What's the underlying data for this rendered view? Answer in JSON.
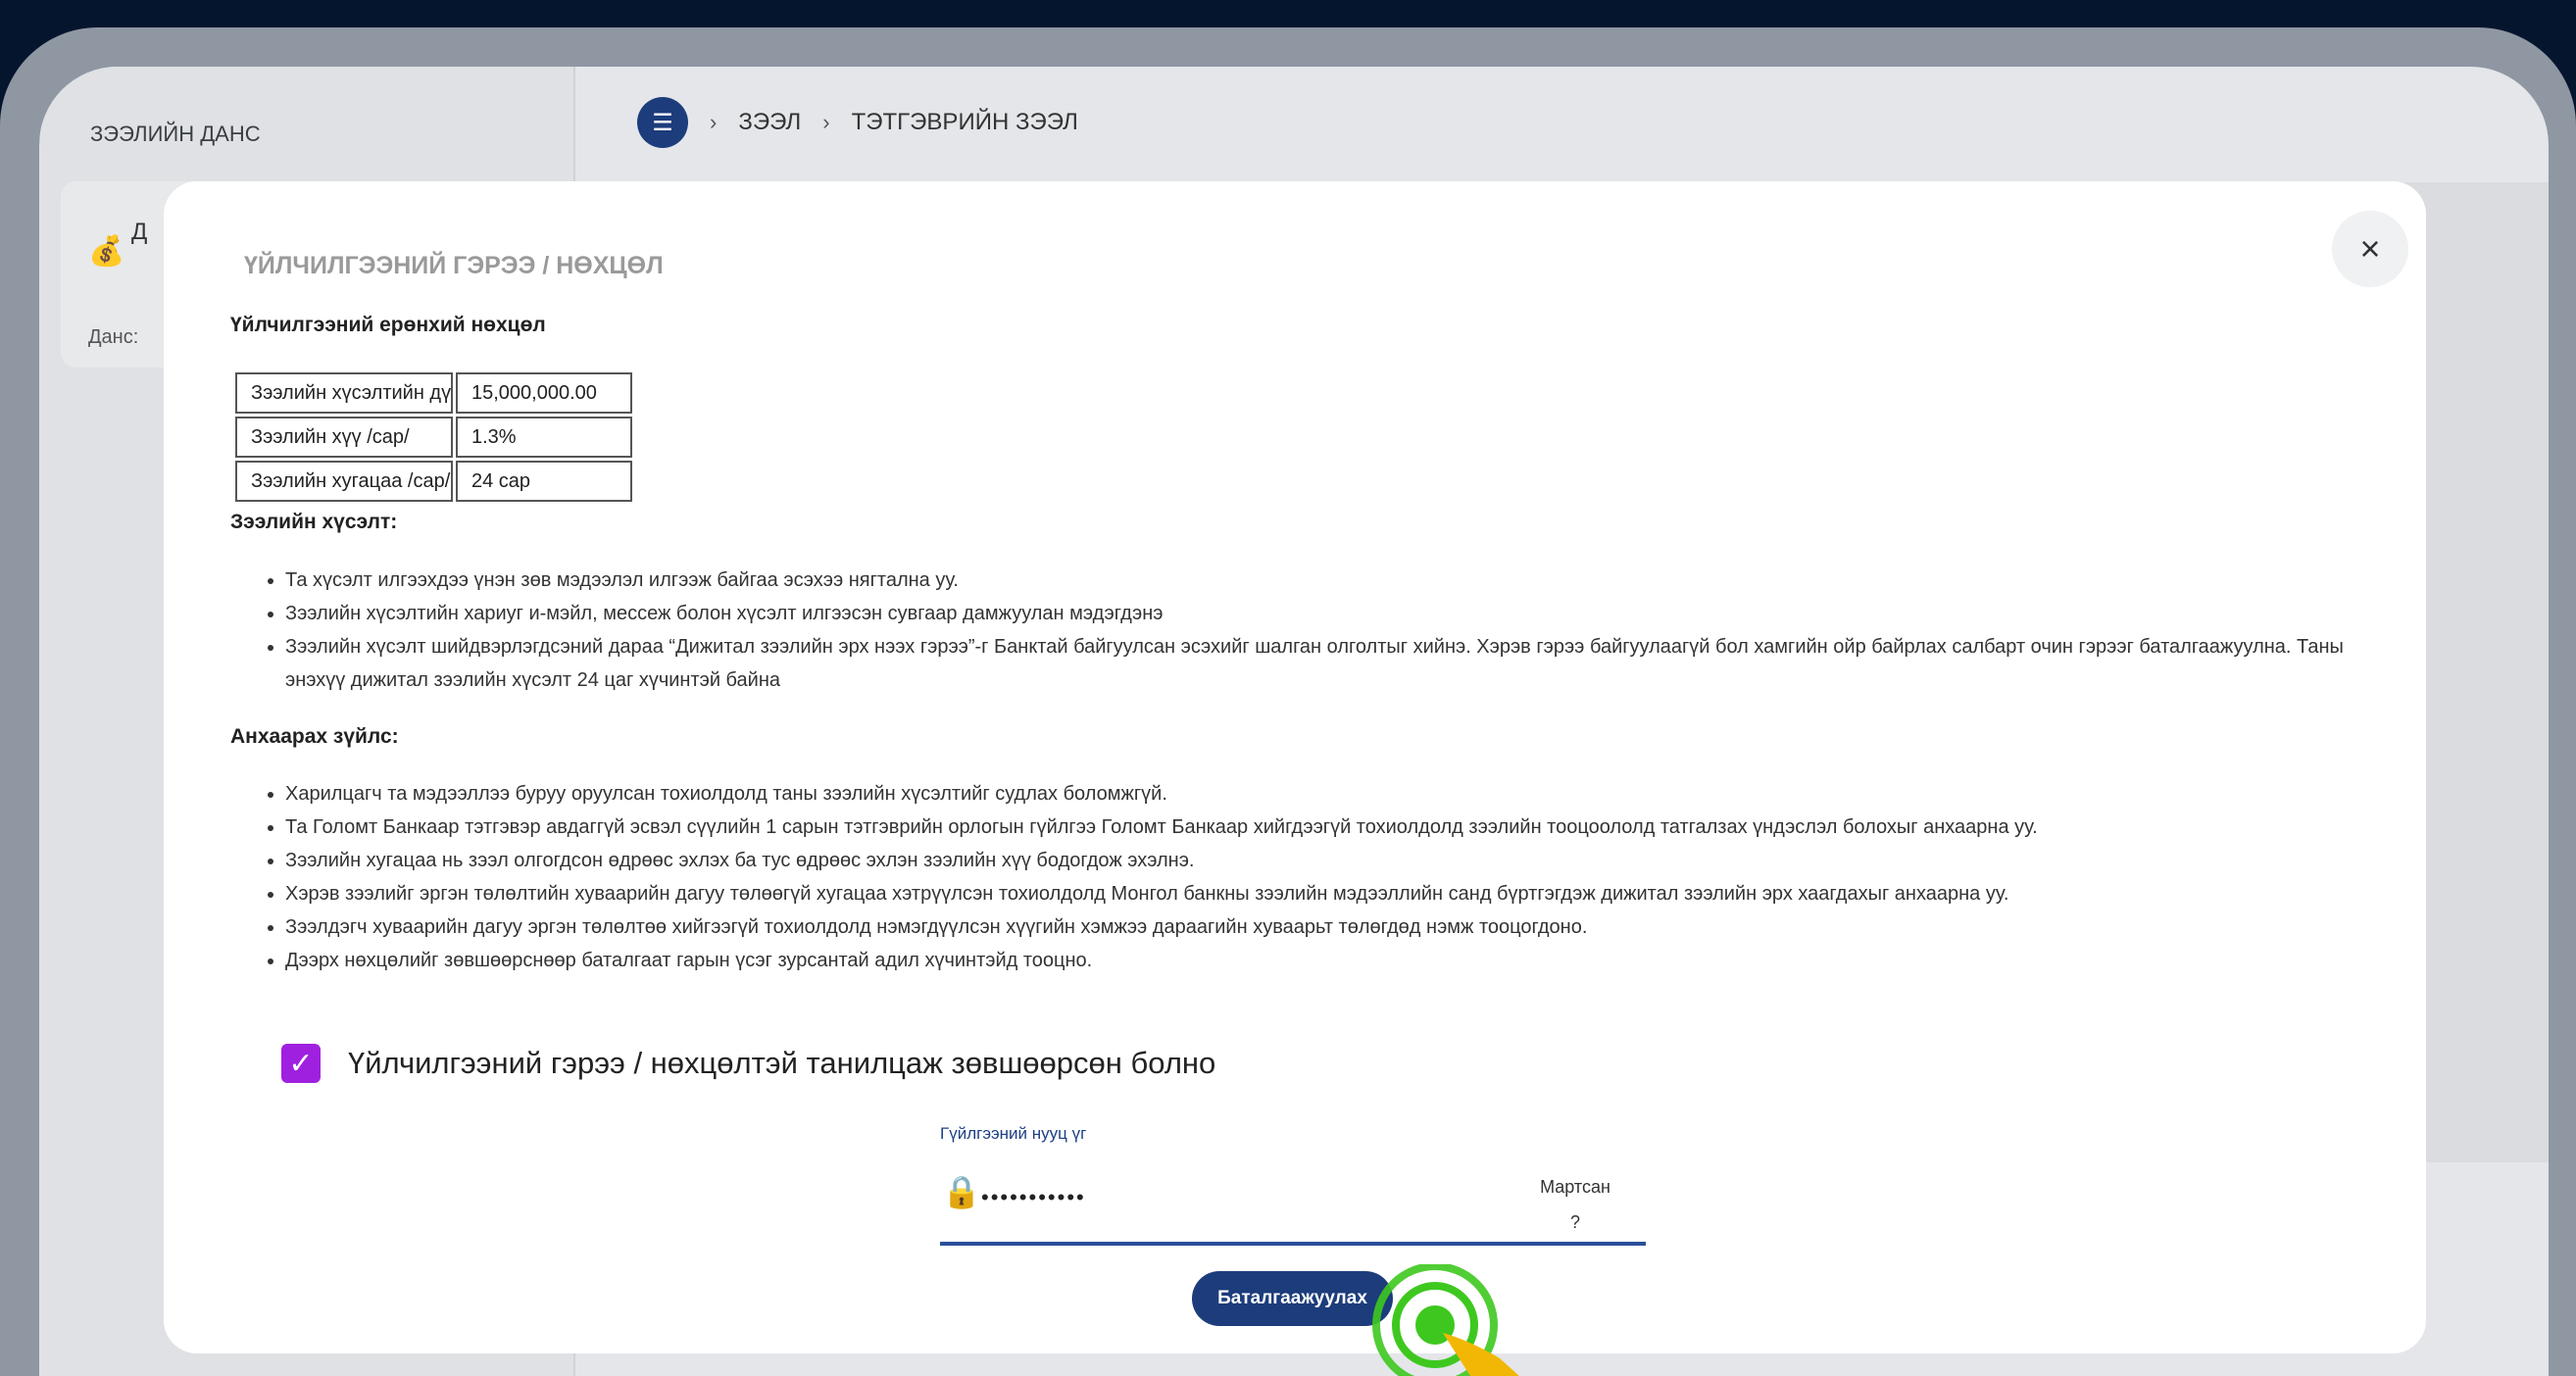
{
  "sidebar": {
    "title": "ЗЭЭЛИЙН ДАНС",
    "account_name": "Д",
    "account_label": "Данс:"
  },
  "breadcrumb": [
    "ЗЭЭЛ",
    "ТЭТГЭВРИЙН ЗЭЭЛ"
  ],
  "modal": {
    "title": "ҮЙЛЧИЛГЭЭНИЙ ГЭРЭЭ / НӨХЦӨЛ",
    "close": "×",
    "general_title": "Үйлчилгээний ерөнхий нөхцөл",
    "terms": [
      {
        "key": "Зээлийн хүсэлтийн дүн",
        "value": "15,000,000.00"
      },
      {
        "key": "Зээлийн хүү /сар/",
        "value": "1.3%"
      },
      {
        "key": "Зээлийн хугацаа /сар/",
        "value": "24 сар"
      }
    ],
    "request_title": "Зээлийн хүсэлт:",
    "request_items": [
      "Та хүсэлт илгээхдээ үнэн зөв мэдээлэл илгээж байгаа эсэхээ нягтална уу.",
      "Зээлийн хүсэлтийн хариуг и-мэйл, мессеж болон хүсэлт илгээсэн сувгаар дамжуулан мэдэгдэнэ",
      "Зээлийн хүсэлт шийдвэрлэгдсэний дараа “Дижитал зээлийн эрх нээх гэрээ”-г Банктай байгуулсан эсэхийг шалган олголтыг хийнэ. Хэрэв гэрээ байгуулаагүй бол хамгийн ойр байрлах салбарт очин гэрээг баталгаажуулна. Таны энэхүү дижитал зээлийн хүсэлт 24 цаг хүчинтэй байна"
    ],
    "notice_title": "Анхаарах зүйлс:",
    "notice_items": [
      "Харилцагч та мэдээллээ буруу оруулсан тохиолдолд таны зээлийн хүсэлтийг судлах боломжгүй.",
      "Та Голомт Банкаар тэтгэвэр авдаггүй эсвэл сүүлийн 1 сарын тэтгэврийн орлогын гүйлгээ Голомт Банкаар хийгдээгүй тохиолдолд зээлийн тооцоололд татгалзах үндэслэл болохыг анхаарна уу.",
      "Зээлийн хугацаа нь зээл олгогдсон өдрөөс эхлэх ба тус өдрөөс эхлэн зээлийн хүү бодогдож эхэлнэ.",
      "Хэрэв зээлийг эргэн төлөлтийн хуваарийн дагуу төлөөгүй хугацаа хэтрүүлсэн тохиолдолд Монгол банкны зээлийн мэдээллийн санд бүртгэгдэж дижитал зээлийн эрх хаагдахыг анхаарна уу.",
      "Зээлдэгч хуваарийн дагуу эргэн төлөлтөө хийгээгүй тохиолдолд нэмэгдүүлсэн хүүгийн хэмжээ дараагийн хуваарьт төлөгдөд нэмж тооцогдоно.",
      "Дээрх нөхцөлийг зөвшөөрснөөр баталгаат гарын үсэг зурсантай адил хүчинтэйд тооцно."
    ],
    "agree_label": "Үйлчилгээний гэрээ / нөхцөлтэй танилцаж зөвшөөрсөн болно",
    "agree_checked": true,
    "password": {
      "label": "Гүйлгээний нууц үг",
      "value": "•••••••••••",
      "forgot_line1": "Мартсан",
      "forgot_line2": "?"
    },
    "confirm_label": "Баталгаажуулах"
  },
  "colors": {
    "primary": "#1c3c7c",
    "checkbox": "#a020e0",
    "click_indicator": "#3ec81f"
  }
}
